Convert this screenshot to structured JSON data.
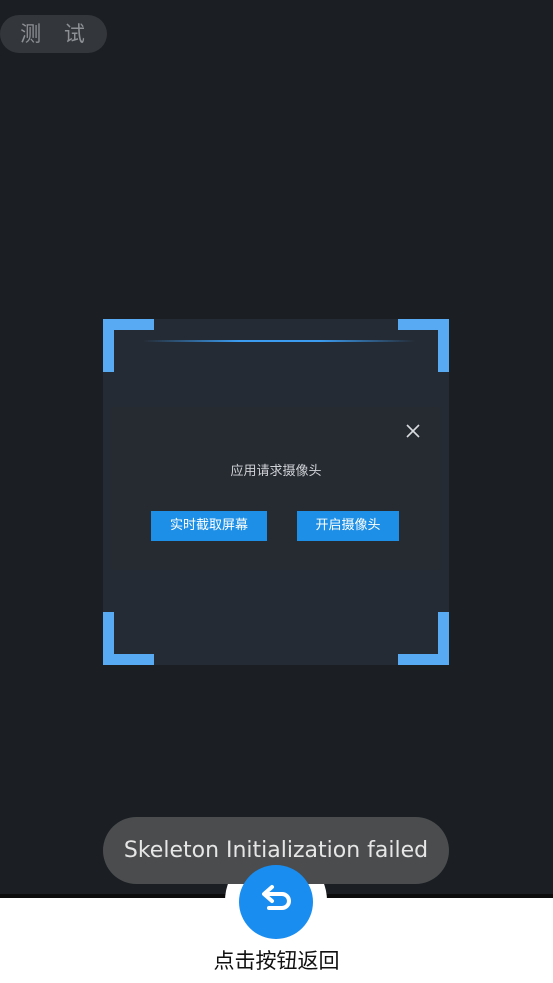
{
  "top_badge": {
    "label": "测 试"
  },
  "scanner": {
    "dialog": {
      "message": "应用请求摄像头",
      "buttons": {
        "capture_screen": "实时截取屏幕",
        "open_camera": "开启摄像头"
      },
      "close_icon": "close-icon"
    }
  },
  "toast": {
    "message": "Skeleton Initialization failed"
  },
  "footer": {
    "back_icon": "undo-arrow-icon",
    "back_label": "点击按钮返回"
  },
  "colors": {
    "accent": "#1a8df0",
    "corner": "#58aaf2",
    "background": "#1b1e22",
    "toast": "#4a4c4e"
  }
}
